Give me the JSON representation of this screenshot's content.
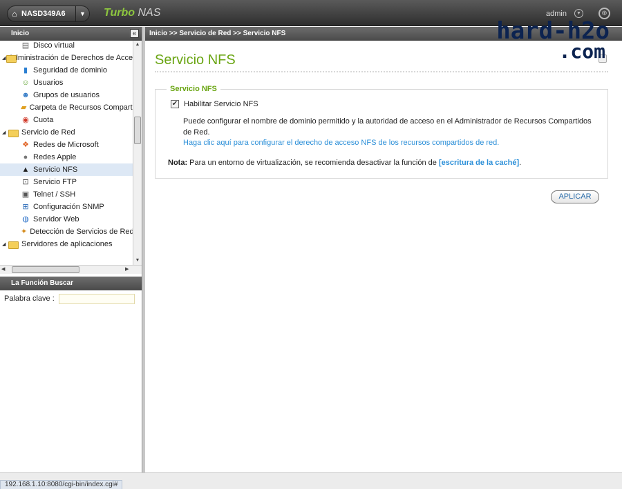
{
  "topbar": {
    "device_name": "NASD349A6",
    "brand_turbo": "Turbo",
    "brand_nas": "NAS",
    "user": "admin"
  },
  "watermark": {
    "line1": "hard-h2o",
    "line2": ".com"
  },
  "left": {
    "header": "Inicio",
    "tree": [
      {
        "label": "Disco virtual",
        "level": 2,
        "icon": "disk-icon"
      },
      {
        "label": "Administración de Derechos de Acceso",
        "level": 1,
        "icon": "folder-icon"
      },
      {
        "label": "Seguridad de dominio",
        "level": 2,
        "icon": "book-icon"
      },
      {
        "label": "Usuarios",
        "level": 2,
        "icon": "user-icon"
      },
      {
        "label": "Grupos de usuarios",
        "level": 2,
        "icon": "group-icon"
      },
      {
        "label": "Carpeta de Recursos Compartidos",
        "level": 2,
        "icon": "share-folder-icon"
      },
      {
        "label": "Cuota",
        "level": 2,
        "icon": "quota-icon"
      },
      {
        "label": "Servicio de Red",
        "level": 1,
        "icon": "folder-icon"
      },
      {
        "label": "Redes de Microsoft",
        "level": 2,
        "icon": "windows-icon"
      },
      {
        "label": "Redes Apple",
        "level": 2,
        "icon": "apple-icon"
      },
      {
        "label": "Servicio NFS",
        "level": 2,
        "icon": "linux-icon"
      },
      {
        "label": "Servicio FTP",
        "level": 2,
        "icon": "ftp-icon"
      },
      {
        "label": "Telnet / SSH",
        "level": 2,
        "icon": "terminal-icon"
      },
      {
        "label": "Configuración SNMP",
        "level": 2,
        "icon": "snmp-icon"
      },
      {
        "label": "Servidor Web",
        "level": 2,
        "icon": "web-globe-icon"
      },
      {
        "label": "Detección de Servicios de Red",
        "level": 2,
        "icon": "discovery-icon"
      },
      {
        "label": "Servidores de aplicaciones",
        "level": 1,
        "icon": "folder-icon"
      }
    ],
    "search_header": "La Función Buscar",
    "search_label": "Palabra clave :",
    "search_value": ""
  },
  "main": {
    "breadcrumb": "Inicio >> Servicio de Red >> Servicio NFS",
    "title": "Servicio NFS",
    "legend": "Servicio NFS",
    "checkbox_label": "Habilitar Servicio NFS",
    "checkbox_checked": true,
    "description": "Puede configurar el nombre de dominio permitido y la autoridad de acceso en el Administrador de Recursos Compartidos de Red.",
    "link_text": "Haga clic aquí para configurar el derecho de acceso NFS de los recursos compartidos de red.",
    "note_label": "Nota:",
    "note_text": "Para un entorno de virtualización, se recomienda desactivar la función de",
    "note_link": "[escritura de la caché]",
    "note_end": ".",
    "apply_label": "APLICAR"
  },
  "status": {
    "url": "192.168.1.10:8080/cgi-bin/index.cgi#"
  },
  "colors": {
    "accent_green": "#6aa513",
    "link_blue": "#2b8fd8",
    "header_gray": "#4a4a4a"
  }
}
